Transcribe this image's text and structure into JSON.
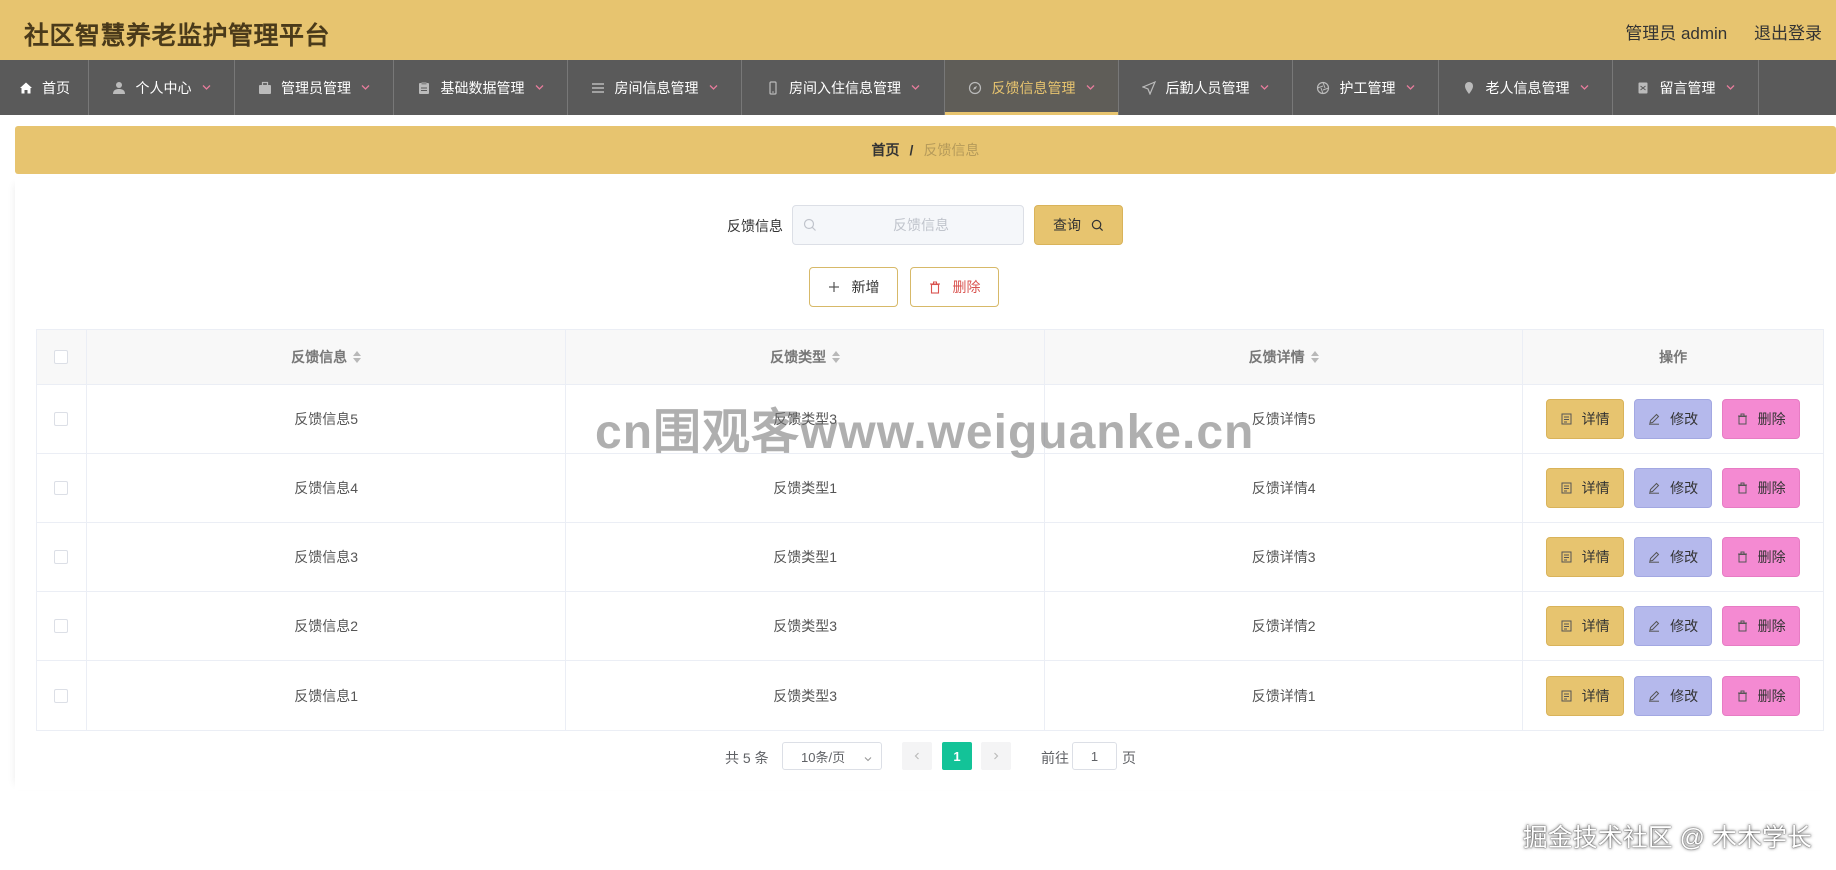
{
  "header": {
    "title": "社区智慧养老监护管理平台",
    "user_label": "管理员 admin",
    "logout_label": "退出登录"
  },
  "nav": {
    "items": [
      {
        "label": "首页",
        "icon": "home-icon",
        "has_dropdown": false
      },
      {
        "label": "个人中心",
        "icon": "user-icon",
        "has_dropdown": true
      },
      {
        "label": "管理员管理",
        "icon": "briefcase-icon",
        "has_dropdown": true
      },
      {
        "label": "基础数据管理",
        "icon": "clipboard-icon",
        "has_dropdown": true
      },
      {
        "label": "房间信息管理",
        "icon": "list-icon",
        "has_dropdown": true
      },
      {
        "label": "房间入住信息管理",
        "icon": "phone-icon",
        "has_dropdown": true
      },
      {
        "label": "反馈信息管理",
        "icon": "compass-icon",
        "has_dropdown": true,
        "active": true
      },
      {
        "label": "后勤人员管理",
        "icon": "navigation-icon",
        "has_dropdown": true
      },
      {
        "label": "护工管理",
        "icon": "aperture-icon",
        "has_dropdown": true
      },
      {
        "label": "老人信息管理",
        "icon": "pin-icon",
        "has_dropdown": true
      },
      {
        "label": "留言管理",
        "icon": "document-icon",
        "has_dropdown": true
      }
    ],
    "accent_color": "#e7c46f"
  },
  "breadcrumb": {
    "home": "首页",
    "separator": "/",
    "current": "反馈信息"
  },
  "search": {
    "label": "反馈信息",
    "placeholder": "反馈信息",
    "value": "",
    "button_label": "查询"
  },
  "actions": {
    "add_label": "新增",
    "delete_label": "删除"
  },
  "table": {
    "columns": [
      "反馈信息",
      "反馈类型",
      "反馈详情",
      "操作"
    ],
    "rows": [
      {
        "info": "反馈信息5",
        "type": "反馈类型3",
        "detail": "反馈详情5"
      },
      {
        "info": "反馈信息4",
        "type": "反馈类型1",
        "detail": "反馈详情4"
      },
      {
        "info": "反馈信息3",
        "type": "反馈类型1",
        "detail": "反馈详情3"
      },
      {
        "info": "反馈信息2",
        "type": "反馈类型3",
        "detail": "反馈详情2"
      },
      {
        "info": "反馈信息1",
        "type": "反馈类型3",
        "detail": "反馈详情1"
      }
    ],
    "row_buttons": {
      "detail": "详情",
      "edit": "修改",
      "delete": "删除"
    },
    "button_colors": {
      "detail": "#e7c46f",
      "edit": "#b5b9ec",
      "delete": "#f48ad2"
    }
  },
  "pagination": {
    "total_text": "共 5 条",
    "page_size": "10条/页",
    "current_page": "1",
    "goto_label": "前往",
    "goto_value": "1",
    "page_suffix": "页",
    "active_color": "#13c398"
  },
  "watermarks": {
    "center": "cn围观客www.weiguanke.cn",
    "footer": "掘金技术社区 @ 木木学长"
  }
}
